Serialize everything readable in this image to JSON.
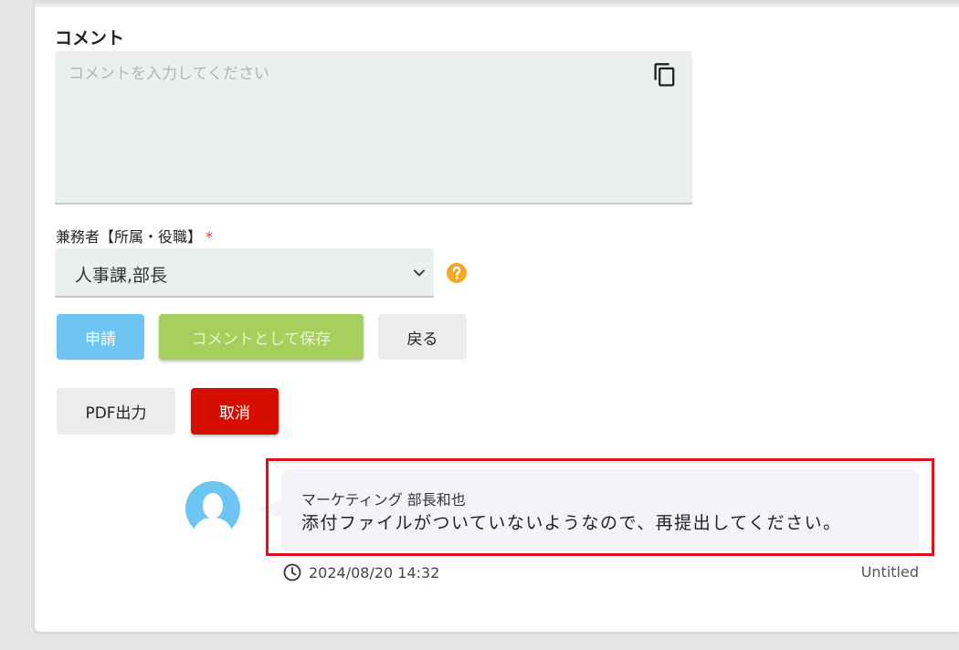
{
  "comment": {
    "title": "コメント",
    "placeholder": "コメントを入力してください",
    "copy_icon": "copy-icon"
  },
  "concurrent": {
    "label": "兼務者【所属・役職】",
    "required_mark": "*",
    "selected": "人事課,部長",
    "help_icon": "question-circle-icon"
  },
  "buttons": {
    "apply": "申請",
    "save_comment": "コメントとして保存",
    "back": "戻る",
    "pdf": "PDF出力",
    "cancel": "取消"
  },
  "history": {
    "author": "マーケティング 部長和也",
    "message": "添付ファイルがついていないようなので、再提出してください。",
    "timestamp": "2024/08/20 14:32",
    "title": "Untitled"
  },
  "colors": {
    "apply": "#6cc5f2",
    "save": "#a6cf5e",
    "cancel": "#d60e00",
    "highlight": "#e0101b",
    "help": "#f5a623"
  }
}
